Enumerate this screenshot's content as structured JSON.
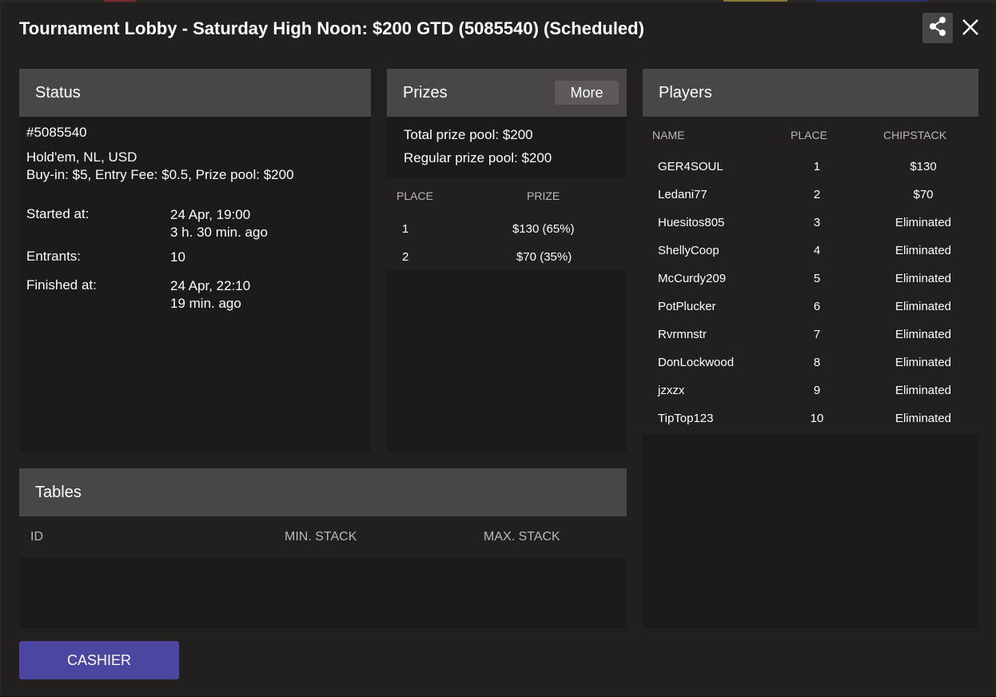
{
  "header": {
    "title": "Tournament Lobby - Saturday High Noon: $200 GTD (5085540) (Scheduled)"
  },
  "status": {
    "heading": "Status",
    "id": "#5085540",
    "game": "Hold'em, NL, USD",
    "buyin": "Buy-in: $5, Entry Fee: $0.5, Prize pool: $200",
    "started_label": "Started at:",
    "started_value": "24 Apr, 19:00",
    "started_ago": "3 h. 30 min. ago",
    "entrants_label": "Entrants:",
    "entrants_value": "10",
    "finished_label": "Finished at:",
    "finished_value": "24 Apr, 22:10",
    "finished_ago": "19 min. ago"
  },
  "prizes": {
    "heading": "Prizes",
    "more_label": "More",
    "total_label": "Total prize pool:",
    "total_value": "$200",
    "regular_label": "Regular prize pool:",
    "regular_value": "$200",
    "columns": [
      "PLACE",
      "PRIZE"
    ],
    "rows": [
      {
        "place": "1",
        "prize": "$130 (65%)"
      },
      {
        "place": "2",
        "prize": "$70 (35%)"
      }
    ]
  },
  "players": {
    "heading": "Players",
    "columns": [
      "NAME",
      "PLACE",
      "CHIPSTACK"
    ],
    "rows": [
      {
        "name": "GER4SOUL",
        "place": "1",
        "chipstack": "$130"
      },
      {
        "name": "Ledani77",
        "place": "2",
        "chipstack": "$70"
      },
      {
        "name": "Huesitos805",
        "place": "3",
        "chipstack": "Eliminated"
      },
      {
        "name": "ShellyCoop",
        "place": "4",
        "chipstack": "Eliminated"
      },
      {
        "name": "McCurdy209",
        "place": "5",
        "chipstack": "Eliminated"
      },
      {
        "name": "PotPlucker",
        "place": "6",
        "chipstack": "Eliminated"
      },
      {
        "name": "Rvrmnstr",
        "place": "7",
        "chipstack": "Eliminated"
      },
      {
        "name": "DonLockwood",
        "place": "8",
        "chipstack": "Eliminated"
      },
      {
        "name": "jzxzx",
        "place": "9",
        "chipstack": "Eliminated"
      },
      {
        "name": "TipTop123",
        "place": "10",
        "chipstack": "Eliminated"
      }
    ]
  },
  "tables": {
    "heading": "Tables",
    "columns": [
      "ID",
      "MIN. STACK",
      "MAX. STACK"
    ]
  },
  "footer": {
    "cashier_label": "CASHIER"
  },
  "icons": {
    "share": "share-icon",
    "close": "close-icon"
  },
  "colors": {
    "panel_header": "#4b4646",
    "cashier_button": "#4b46a0",
    "background": "#231f1f"
  }
}
